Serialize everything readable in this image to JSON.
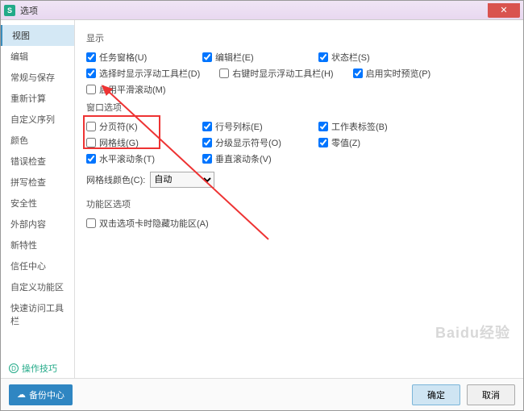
{
  "titlebar": {
    "icon": "S",
    "title": "选项"
  },
  "sidebar": {
    "items": [
      {
        "label": "视图",
        "active": true
      },
      {
        "label": "编辑"
      },
      {
        "label": "常规与保存"
      },
      {
        "label": "重新计算"
      },
      {
        "label": "自定义序列"
      },
      {
        "label": "颜色"
      },
      {
        "label": "错误检查"
      },
      {
        "label": "拼写检查"
      },
      {
        "label": "安全性"
      },
      {
        "label": "外部内容"
      },
      {
        "label": "新特性"
      },
      {
        "label": "信任中心"
      },
      {
        "label": "自定义功能区"
      },
      {
        "label": "快速访问工具栏"
      }
    ]
  },
  "content": {
    "section_display": "显示",
    "display_items": [
      {
        "label": "任务窗格(U)",
        "checked": true
      },
      {
        "label": "编辑栏(E)",
        "checked": true
      },
      {
        "label": "状态栏(S)",
        "checked": true
      },
      {
        "label": "选择时显示浮动工具栏(D)",
        "checked": true
      },
      {
        "label": "右键时显示浮动工具栏(H)",
        "checked": false
      },
      {
        "label": "启用实时预览(P)",
        "checked": true
      },
      {
        "label": "启用平滑滚动(M)",
        "checked": false
      }
    ],
    "section_window": "窗口选项",
    "window_items": [
      {
        "label": "分页符(K)",
        "checked": false
      },
      {
        "label": "行号列标(E)",
        "checked": true
      },
      {
        "label": "工作表标签(B)",
        "checked": true
      },
      {
        "label": "网格线(G)",
        "checked": false
      },
      {
        "label": "分级显示符号(O)",
        "checked": true
      },
      {
        "label": "零值(Z)",
        "checked": true
      },
      {
        "label": "水平滚动条(T)",
        "checked": true
      },
      {
        "label": "垂直滚动条(V)",
        "checked": true
      }
    ],
    "gridcolor_label": "网格线颜色(C):",
    "gridcolor_value": "自动",
    "section_ribbon": "功能区选项",
    "ribbon_item": {
      "label": "双击选项卡时隐藏功能区(A)",
      "checked": false
    }
  },
  "footer": {
    "backup": "备份中心",
    "tip": "操作技巧",
    "ok": "确定",
    "cancel": "取消"
  },
  "watermark": "Baidu经验"
}
